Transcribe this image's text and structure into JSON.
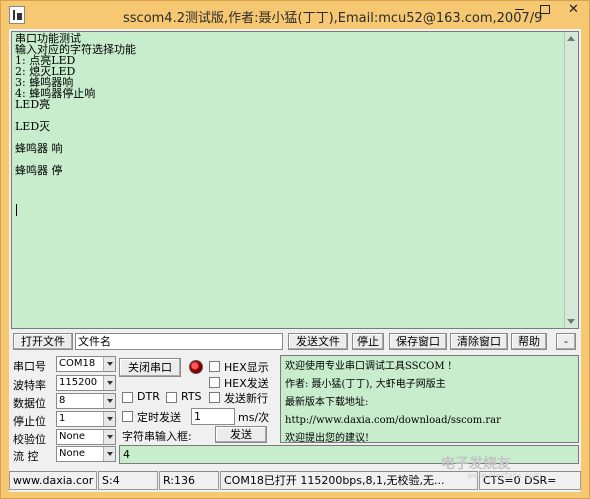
{
  "window": {
    "title": "sscom4.2测试版,作者:聂小猛(丁丁),Email:mcu52@163.com,2007/9"
  },
  "receive": {
    "lines": [
      "串口功能测试",
      "输入对应的字符选择功能",
      "1: 点亮LED",
      "2: 熄灭LED",
      "3: 蜂鸣器响",
      "4: 蜂鸣器停止响",
      "LED亮",
      "",
      "LED灭",
      "",
      "蜂鸣器 响",
      "",
      "蜂鸣器 停"
    ]
  },
  "toolbar": {
    "open_file": "打开文件",
    "file_name": "文件名",
    "send_file": "发送文件",
    "stop": "停止",
    "save_window": "保存窗口",
    "clear_window": "清除窗口",
    "help": "帮助",
    "collapse": "-"
  },
  "settings": {
    "port_label": "串口号",
    "port_value": "COM18",
    "baud_label": "波特率",
    "baud_value": "115200",
    "databits_label": "数据位",
    "databits_value": "8",
    "stopbits_label": "停止位",
    "stopbits_value": "1",
    "parity_label": "校验位",
    "parity_value": "None",
    "flow_label": "流 控",
    "flow_value": "None"
  },
  "controls": {
    "close_port": "关闭串口",
    "hex_display": "HEX显示",
    "hex_send": "HEX发送",
    "dtr": "DTR",
    "rts": "RTS",
    "send_newline": "发送新行",
    "timed_send": "定时发送",
    "interval_value": "1",
    "interval_unit": "ms/次",
    "string_input_label": "字符串输入框:",
    "send_button": "发送",
    "send_text": "4"
  },
  "info": {
    "lines": [
      "欢迎使用专业串口调试工具SSCOM !",
      "作者: 聂小猛(丁丁), 大虾电子网版主",
      "最新版本下载地址:",
      "http://www.daxia.com/download/sscom.rar",
      "欢迎提出您的建议!"
    ]
  },
  "status": {
    "site": "www.daxia.cor",
    "sent": "S:4",
    "received": "R:136",
    "port_status": "COM18已打开  115200bps,8,1,无校验,无...",
    "signals": "CTS=0 DSR="
  },
  "watermark": {
    "text": "电子发烧友",
    "sub": "www.elecfans.com"
  }
}
